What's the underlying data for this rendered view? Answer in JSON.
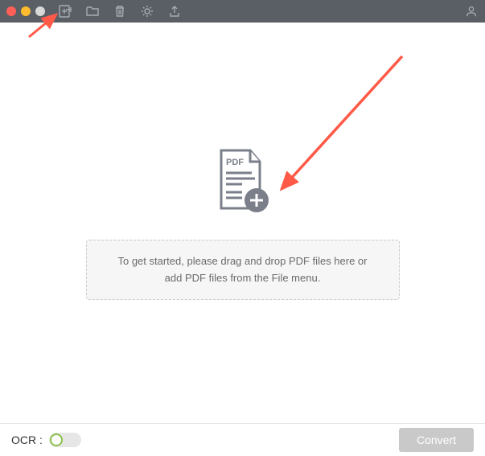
{
  "colors": {
    "titlebar": "#5a5e65",
    "icon": "#a8acb3",
    "close": "#ff5f57",
    "minimize": "#febc2e",
    "maximize": "#d8d8d8",
    "hint_border": "#c8c8c8",
    "hint_bg": "#f6f6f6",
    "hint_text": "#6a6a6a",
    "ocr_ring": "#8bc34a",
    "convert_bg": "#c9c9c9",
    "arrow": "#ff5a47",
    "doc_stroke": "#7a7f8a"
  },
  "toolbar": {
    "add_file": "add-file-icon",
    "folder": "folder-icon",
    "trash": "trash-icon",
    "settings": "gear-icon",
    "export": "export-icon",
    "account": "account-icon"
  },
  "main": {
    "pdf_label": "PDF",
    "hint_text": "To get started, please drag and drop PDF files here or add PDF files from the File menu."
  },
  "bottom": {
    "ocr_label": "OCR :",
    "ocr_enabled": false,
    "convert_label": "Convert"
  }
}
